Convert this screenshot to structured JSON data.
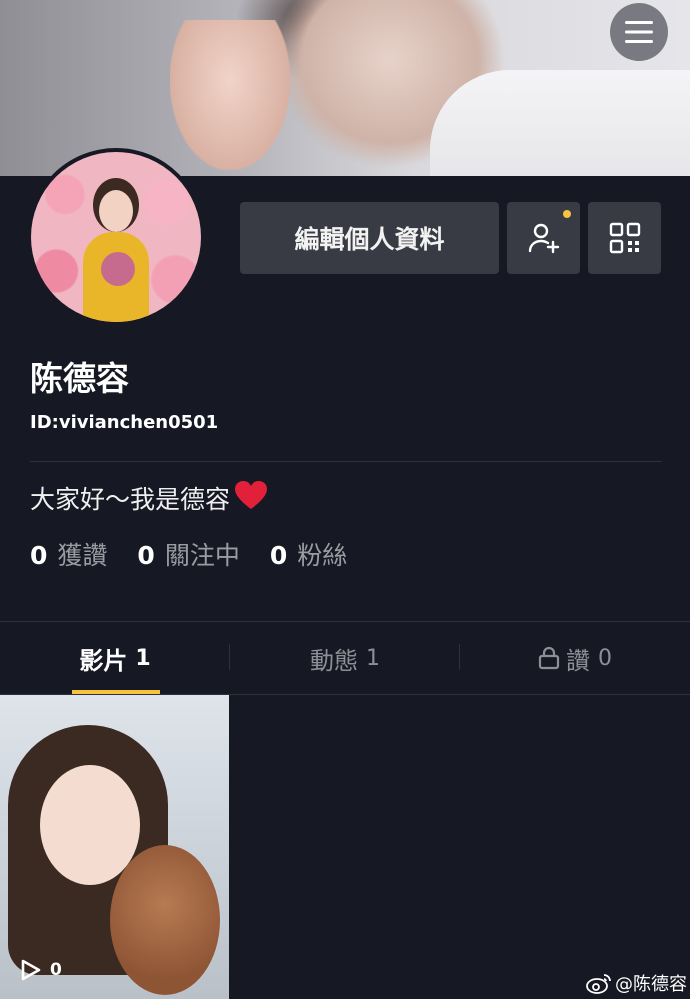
{
  "header": {
    "menu_icon": "hamburger-menu-icon"
  },
  "profile": {
    "name": "陈德容",
    "id_text": "ID:vivianchen0501",
    "bio": "大家好～我是德容",
    "bio_emoji": "❤️",
    "edit_button_label": "編輯個人資料",
    "add_friend_icon": "add-user-icon",
    "qr_icon": "qr-code-icon",
    "notification_dot_color": "#f6c443"
  },
  "stats": [
    {
      "num": "0",
      "label": "獲讚"
    },
    {
      "num": "0",
      "label": "關注中"
    },
    {
      "num": "0",
      "label": "粉絲"
    }
  ],
  "tabs": [
    {
      "label": "影片",
      "count": "1"
    },
    {
      "label": "動態",
      "count": "1"
    },
    {
      "label": "讚",
      "count": "0",
      "icon": "lock-icon"
    }
  ],
  "videos": [
    {
      "play_count": "0"
    }
  ],
  "watermark": {
    "text": "@陈德容",
    "icon": "weibo-icon"
  },
  "colors": {
    "background": "#161823",
    "accent": "#f6c443",
    "button": "#393b44"
  }
}
